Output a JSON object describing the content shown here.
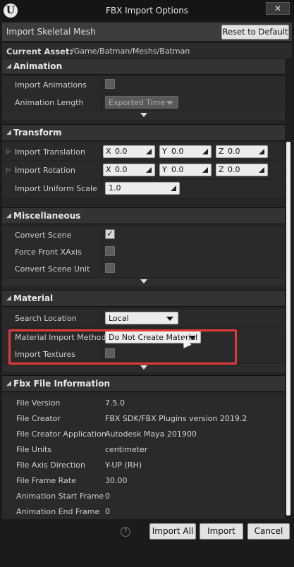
{
  "window": {
    "title": "FBX Import Options",
    "close_glyph": "✕",
    "logo_glyph": "U"
  },
  "header": {
    "title": "Import Skeletal Mesh",
    "reset_label": "Reset to Default"
  },
  "asset": {
    "label": "Current Asset:",
    "path": "/Game/Batman/Meshs/Batman"
  },
  "sections": {
    "animation": {
      "title": "Animation",
      "import_animations": {
        "label": "Import Animations",
        "checked": false
      },
      "animation_length": {
        "label": "Animation Length",
        "value": "Exported Time"
      }
    },
    "transform": {
      "title": "Transform",
      "import_translation": {
        "label": "Import Translation",
        "x": "0.0",
        "y": "0.0",
        "z": "0.0"
      },
      "import_rotation": {
        "label": "Import Rotation",
        "x": "0.0",
        "y": "0.0",
        "z": "0.0"
      },
      "import_uniform_scale": {
        "label": "Import Uniform Scale",
        "value": "1.0"
      },
      "axis_labels": {
        "x": "X",
        "y": "Y",
        "z": "Z"
      }
    },
    "miscellaneous": {
      "title": "Miscellaneous",
      "convert_scene": {
        "label": "Convert Scene",
        "checked": true
      },
      "force_front_xaxis": {
        "label": "Force Front XAxis",
        "checked": false
      },
      "convert_scene_unit": {
        "label": "Convert Scene Unit",
        "checked": false
      }
    },
    "material": {
      "title": "Material",
      "search_location": {
        "label": "Search Location",
        "value": "Local"
      },
      "material_import_method": {
        "label": "Material Import Method",
        "value": "Do Not Create Material"
      },
      "import_textures": {
        "label": "Import Textures",
        "checked": false
      }
    },
    "fbx_info": {
      "title": "Fbx File Information",
      "rows": [
        {
          "label": "File Version",
          "value": "7.5.0"
        },
        {
          "label": "File Creator",
          "value": "FBX SDK/FBX Plugins version 2019.2"
        },
        {
          "label": "File Creator Application",
          "value": "Autodesk Maya 201900"
        },
        {
          "label": "File Units",
          "value": "centimeter"
        },
        {
          "label": "File Axis Direction",
          "value": "Y-UP (RH)"
        },
        {
          "label": "File Frame Rate",
          "value": "30.00"
        },
        {
          "label": "Animation Start Frame",
          "value": "0"
        },
        {
          "label": "Animation End Frame",
          "value": "0"
        }
      ]
    }
  },
  "footer": {
    "help_glyph": "?",
    "import_all_label": "Import All",
    "import_label": "Import",
    "cancel_label": "Cancel"
  },
  "colors": {
    "highlight_border": "#e03a3a",
    "panel_bg": "#252525",
    "button_bg": "#e2e2e2"
  }
}
